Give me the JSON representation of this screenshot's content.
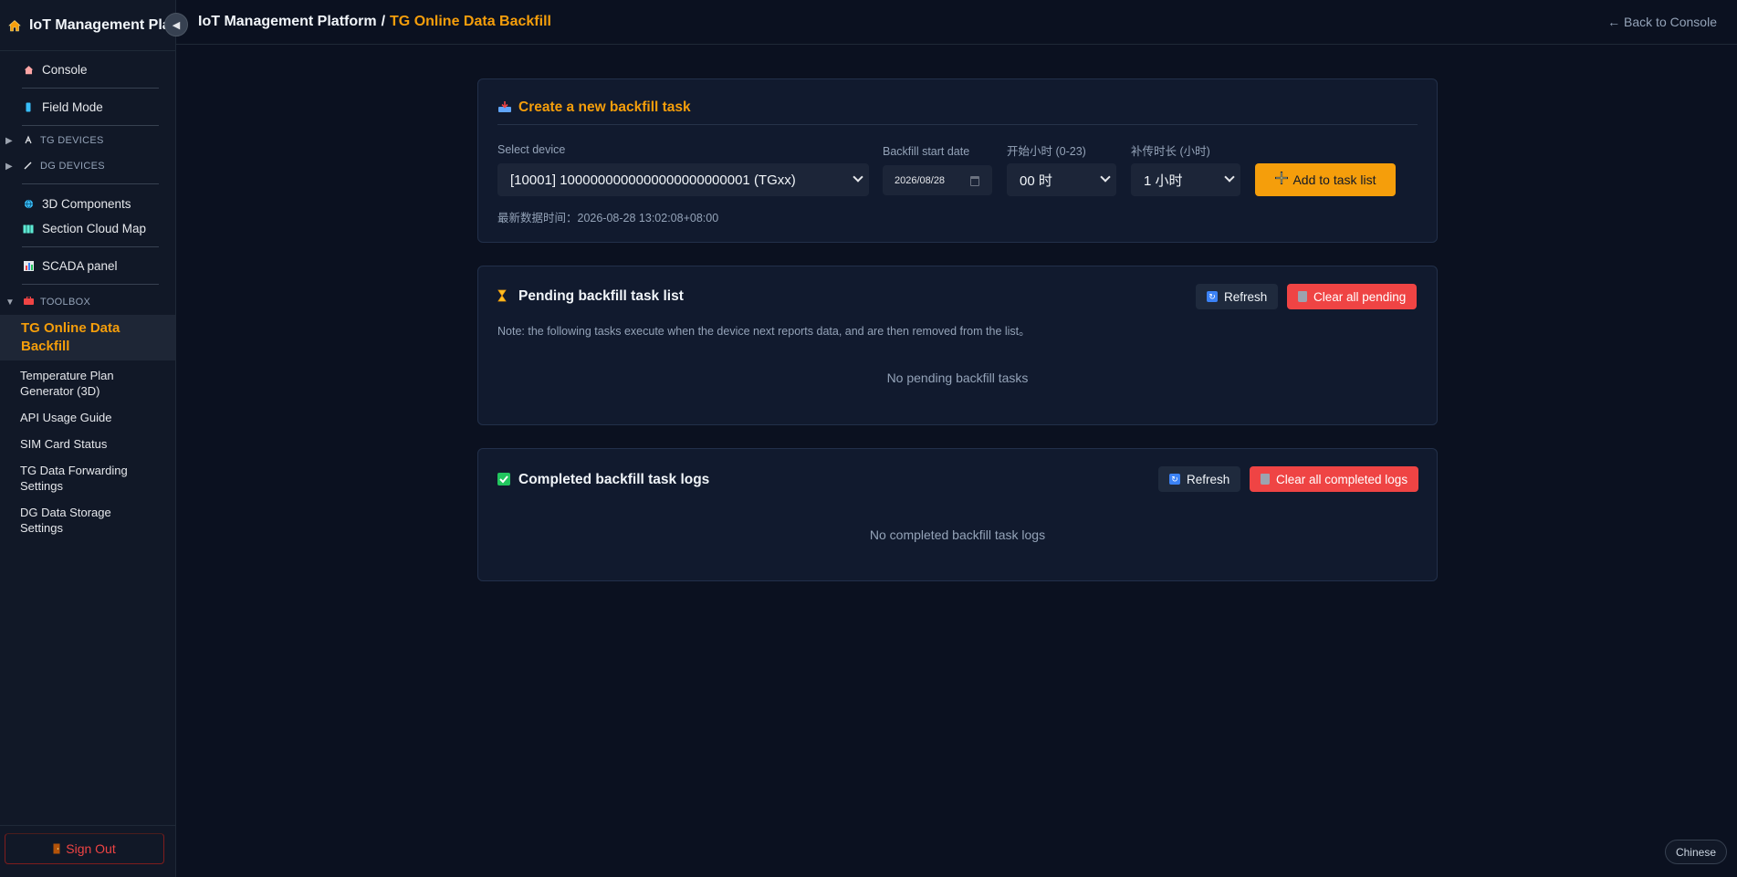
{
  "app": {
    "title": "IoT Management Platform",
    "sidebar_brand": "IoT Management Plat"
  },
  "header": {
    "breadcrumb_root": "IoT Management Platform",
    "breadcrumb_sep": "/",
    "breadcrumb_current": "TG Online Data Backfill",
    "back_link": "← Back to Console"
  },
  "sidebar": {
    "console": "Console",
    "field_mode": "Field Mode",
    "tg_devices": "TG DEVICES",
    "dg_devices": "DG DEVICES",
    "components_3d": "3D Components",
    "section_cloud_map": "Section Cloud Map",
    "scada_panel": "SCADA panel",
    "toolbox": "TOOLBOX",
    "tools": [
      "TG Online Data Backfill",
      "Temperature Plan Generator (3D)",
      "API Usage Guide",
      "SIM Card Status",
      "TG Data Forwarding Settings",
      "DG Data Storage Settings"
    ],
    "sign_out": "Sign Out",
    "collapse_icon": "◀"
  },
  "create_task": {
    "title": "Create a new backfill task",
    "device_label": "Select device",
    "device_value": "[10001] 1000000000000000000000001 (TGxx)",
    "date_label": "Backfill start date",
    "date_value": "2026/08/28",
    "hour_label": "开始小时 (0-23)",
    "hour_value": "00 时",
    "duration_label": "补传时长 (小时)",
    "duration_value": "1 小时",
    "add_button": "Add to task list",
    "latest_time": "最新数据时间：2026-08-28 13:02:08+08:00"
  },
  "pending": {
    "title": "Pending backfill task list",
    "refresh": "Refresh",
    "clear": "Clear all pending",
    "note": "Note: the following tasks execute when the device next reports data, and are then removed from the list。",
    "empty": "No pending backfill tasks"
  },
  "completed": {
    "title": "Completed backfill task logs",
    "refresh": "Refresh",
    "clear": "Clear all completed logs",
    "empty": "No completed backfill task logs"
  },
  "language_button": "Chinese",
  "colors": {
    "accent": "#f59e0b",
    "danger": "#ef4444",
    "background": "#0b1120",
    "panel": "#111a2e"
  }
}
